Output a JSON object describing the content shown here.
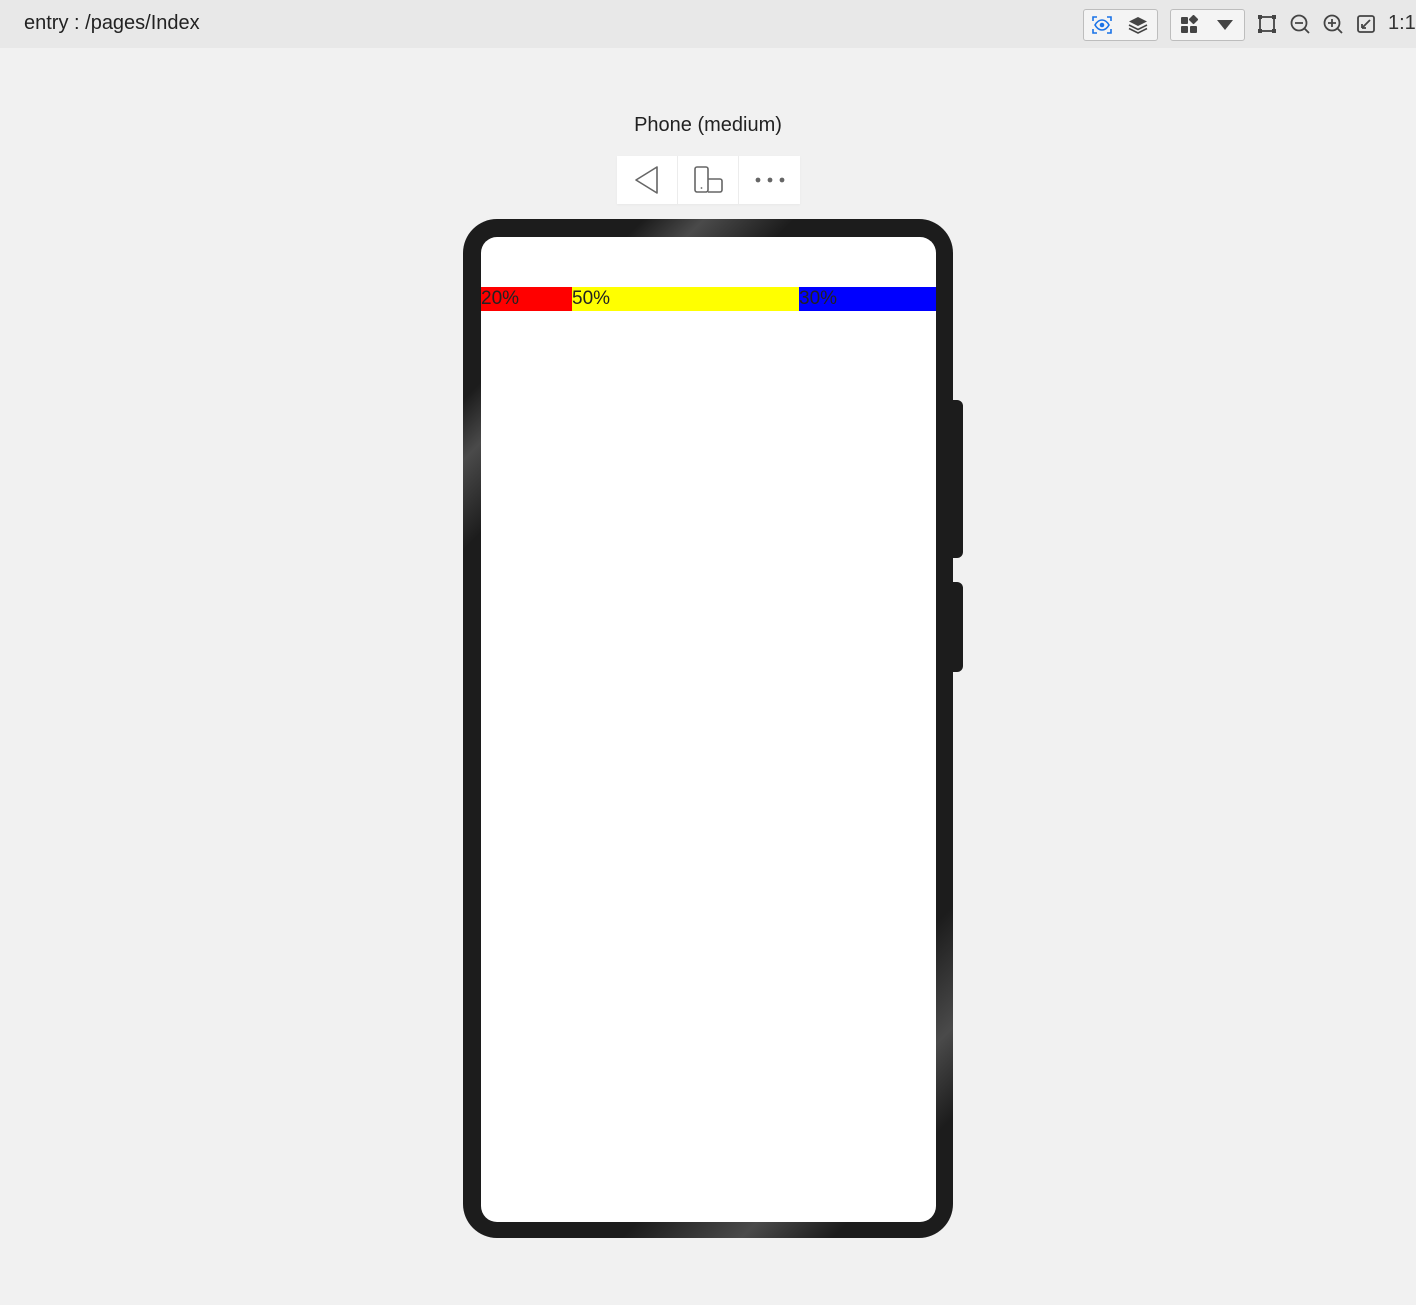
{
  "header": {
    "route": "entry : /pages/Index",
    "zoom_ratio_label": "1:1",
    "icons": [
      "inspect-eye-icon",
      "layers-icon",
      "components-icon",
      "dropdown-arrow-icon",
      "select-frame-icon",
      "zoom-out-icon",
      "zoom-in-icon",
      "fit-screen-icon"
    ]
  },
  "device": {
    "name": "Phone (medium)",
    "tools": [
      "back-icon",
      "rotate-device-icon",
      "more-icon"
    ]
  },
  "app": {
    "cells": [
      {
        "label": "20%",
        "color": "#ff0000"
      },
      {
        "label": "50%",
        "color": "#ffff00"
      },
      {
        "label": "30%",
        "color": "#0000ff"
      }
    ]
  }
}
